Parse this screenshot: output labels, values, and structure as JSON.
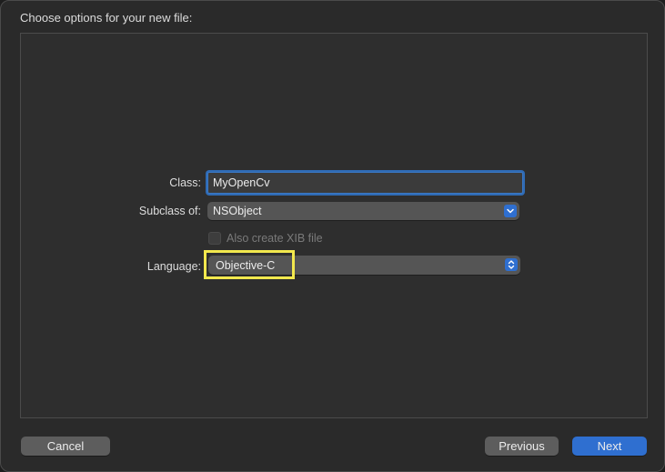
{
  "sheet": {
    "title": "Choose options for your new file:"
  },
  "form": {
    "class_label": "Class:",
    "class_value": "MyOpenCv",
    "subclass_label": "Subclass of:",
    "subclass_value": "NSObject",
    "xib_label": "Also create XIB file",
    "xib_checked": false,
    "language_label": "Language:",
    "language_value": "Objective-C"
  },
  "buttons": {
    "cancel": "Cancel",
    "previous": "Previous",
    "next": "Next"
  },
  "colors": {
    "accent": "#2f6fd0",
    "highlight": "#f2e84d"
  }
}
